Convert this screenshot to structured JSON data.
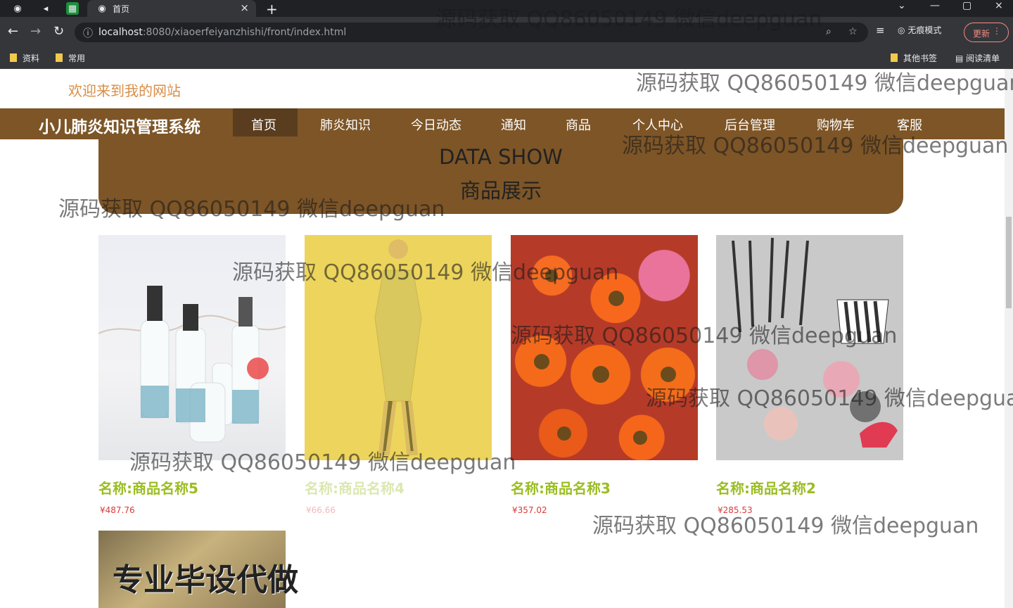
{
  "browser": {
    "tab_title": "首页",
    "new_tab_symbol": "+",
    "url_host": "localhost",
    "url_path": ":8080/xiaoerfeiyanzhishi/front/index.html",
    "incognito_label": "无痕模式",
    "update_label": "更新",
    "bookmarks": [
      "资料",
      "常用"
    ],
    "other_bookmarks": "其他书签",
    "reading_list": "阅读清单"
  },
  "site": {
    "welcome": "欢迎来到我的网站",
    "title": "小儿肺炎知识管理系统",
    "nav": [
      "首页",
      "肺炎知识",
      "今日动态",
      "通知",
      "商品",
      "个人中心",
      "后台管理",
      "购物车",
      "客服"
    ]
  },
  "section": {
    "english_title": "DATA SHOW",
    "chinese_title": "商品展示"
  },
  "products": [
    {
      "name": "名称:商品名称5",
      "price": "¥487.76"
    },
    {
      "name": "名称:商品名称4",
      "price": "¥66.66"
    },
    {
      "name": "名称:商品名称3",
      "price": "¥357.02"
    },
    {
      "name": "名称:商品名称2",
      "price": "¥285.53"
    }
  ],
  "watermark": "源码获取 QQ86050149 微信deepguan",
  "overlay": "专业毕设代做",
  "colors": {
    "nav_brown": "#7d5527",
    "accent_green": "#9bbd22",
    "price_red": "#d83a3a",
    "welcome_orange": "#d88e46"
  }
}
